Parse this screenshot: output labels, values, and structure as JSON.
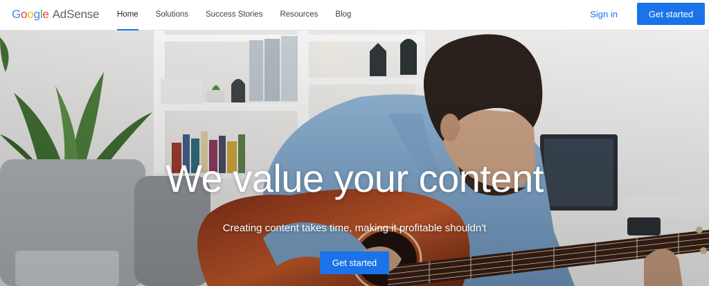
{
  "brand": {
    "google_letters": [
      "G",
      "o",
      "o",
      "g",
      "l",
      "e"
    ],
    "product": "AdSense"
  },
  "nav": {
    "items": [
      {
        "label": "Home",
        "active": true
      },
      {
        "label": "Solutions",
        "active": false
      },
      {
        "label": "Success Stories",
        "active": false
      },
      {
        "label": "Resources",
        "active": false
      },
      {
        "label": "Blog",
        "active": false
      }
    ],
    "sign_in": "Sign in",
    "cta": "Get started"
  },
  "hero": {
    "title": "We value your content",
    "subtitle": "Creating content takes time, making it profitable shouldn't",
    "cta": "Get started"
  },
  "colors": {
    "accent": "#1a73e8",
    "google": [
      "#4285f4",
      "#ea4335",
      "#fbbc05",
      "#4285f4",
      "#34a853",
      "#ea4335"
    ]
  }
}
